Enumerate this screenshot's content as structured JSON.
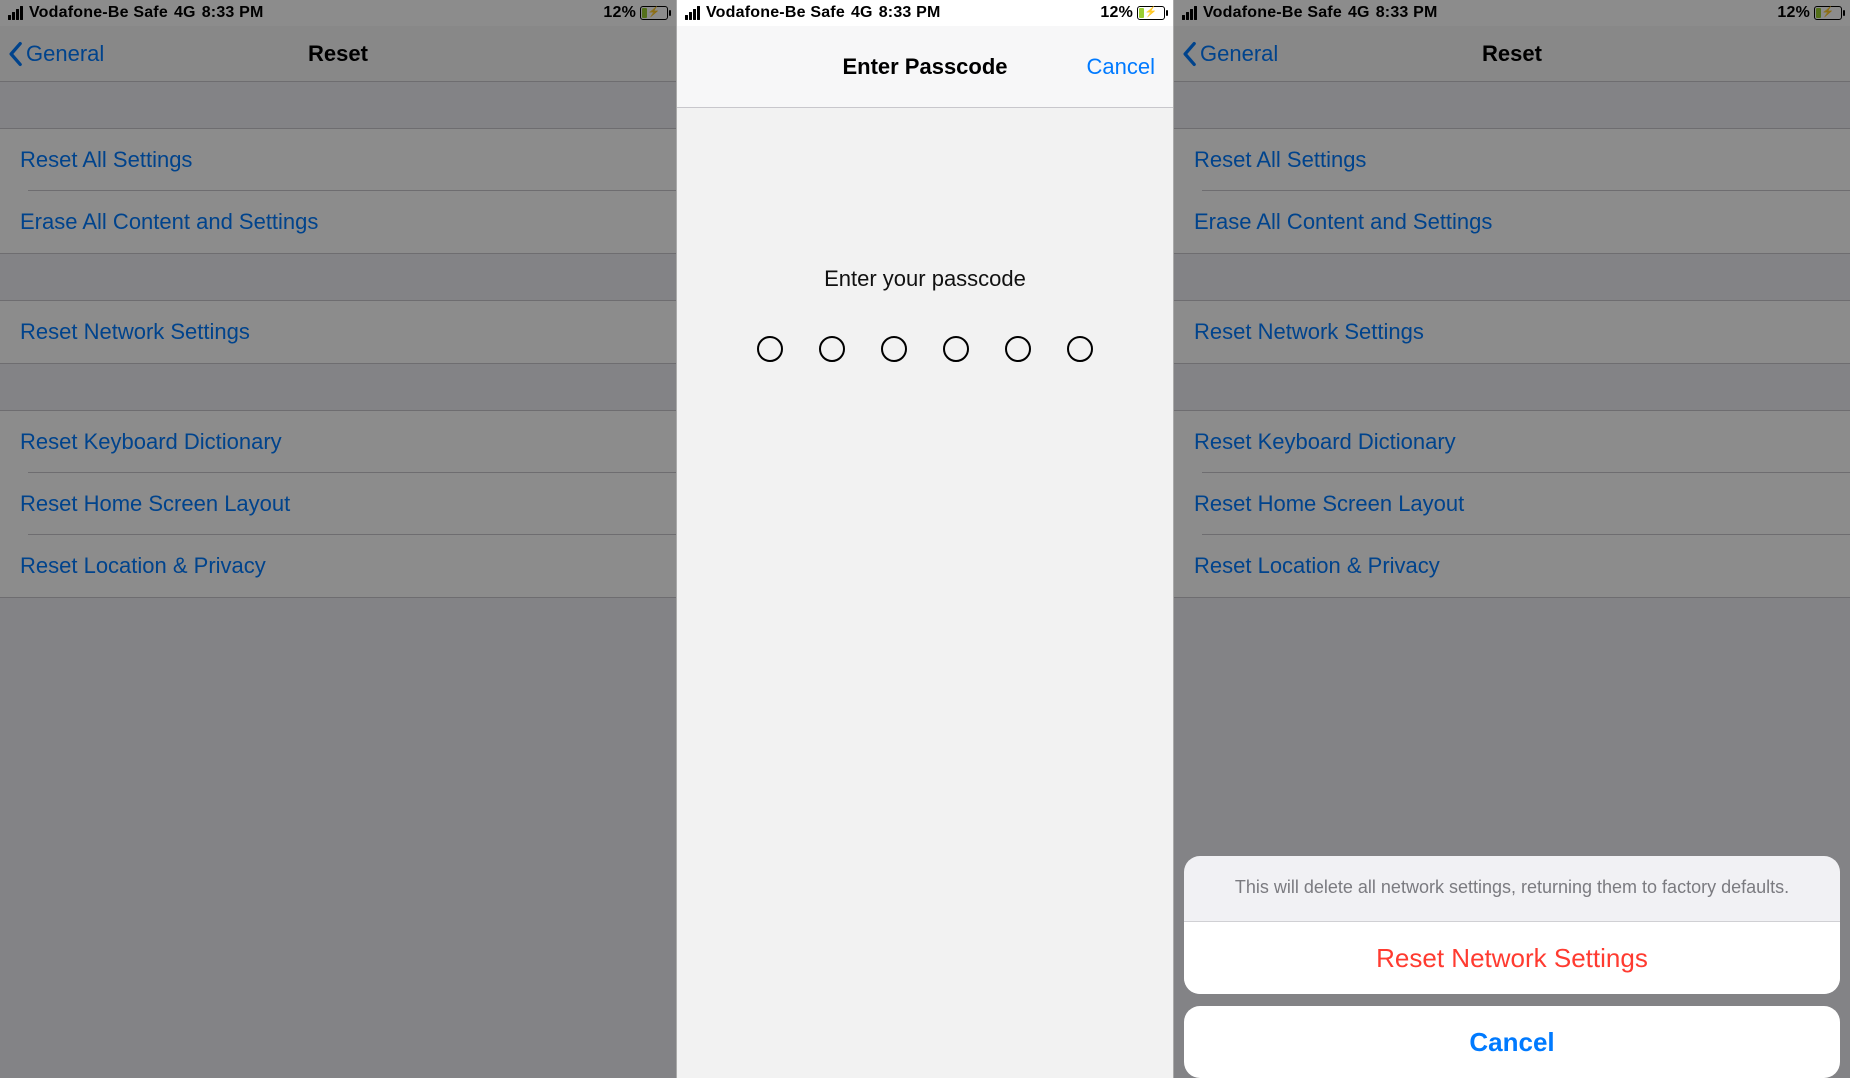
{
  "status": {
    "carrier": "Vodafone-Be Safe",
    "network": "4G",
    "time": "8:33 PM",
    "battery": "12%"
  },
  "left": {
    "back_label": "General",
    "title": "Reset",
    "items": {
      "reset_all": "Reset All Settings",
      "erase_all": "Erase All Content and Settings",
      "reset_network": "Reset Network Settings",
      "reset_keyboard": "Reset Keyboard Dictionary",
      "reset_home": "Reset Home Screen Layout",
      "reset_location": "Reset Location & Privacy"
    }
  },
  "center": {
    "title": "Enter Passcode",
    "cancel": "Cancel",
    "prompt": "Enter your passcode"
  },
  "right": {
    "back_label": "General",
    "title": "Reset",
    "items": {
      "reset_all": "Reset All Settings",
      "erase_all": "Erase All Content and Settings",
      "reset_network": "Reset Network Settings",
      "reset_keyboard": "Reset Keyboard Dictionary",
      "reset_home": "Reset Home Screen Layout",
      "reset_location": "Reset Location & Privacy"
    },
    "sheet": {
      "message": "This will delete all network settings, returning them to factory defaults.",
      "confirm": "Reset Network Settings",
      "cancel": "Cancel"
    }
  }
}
